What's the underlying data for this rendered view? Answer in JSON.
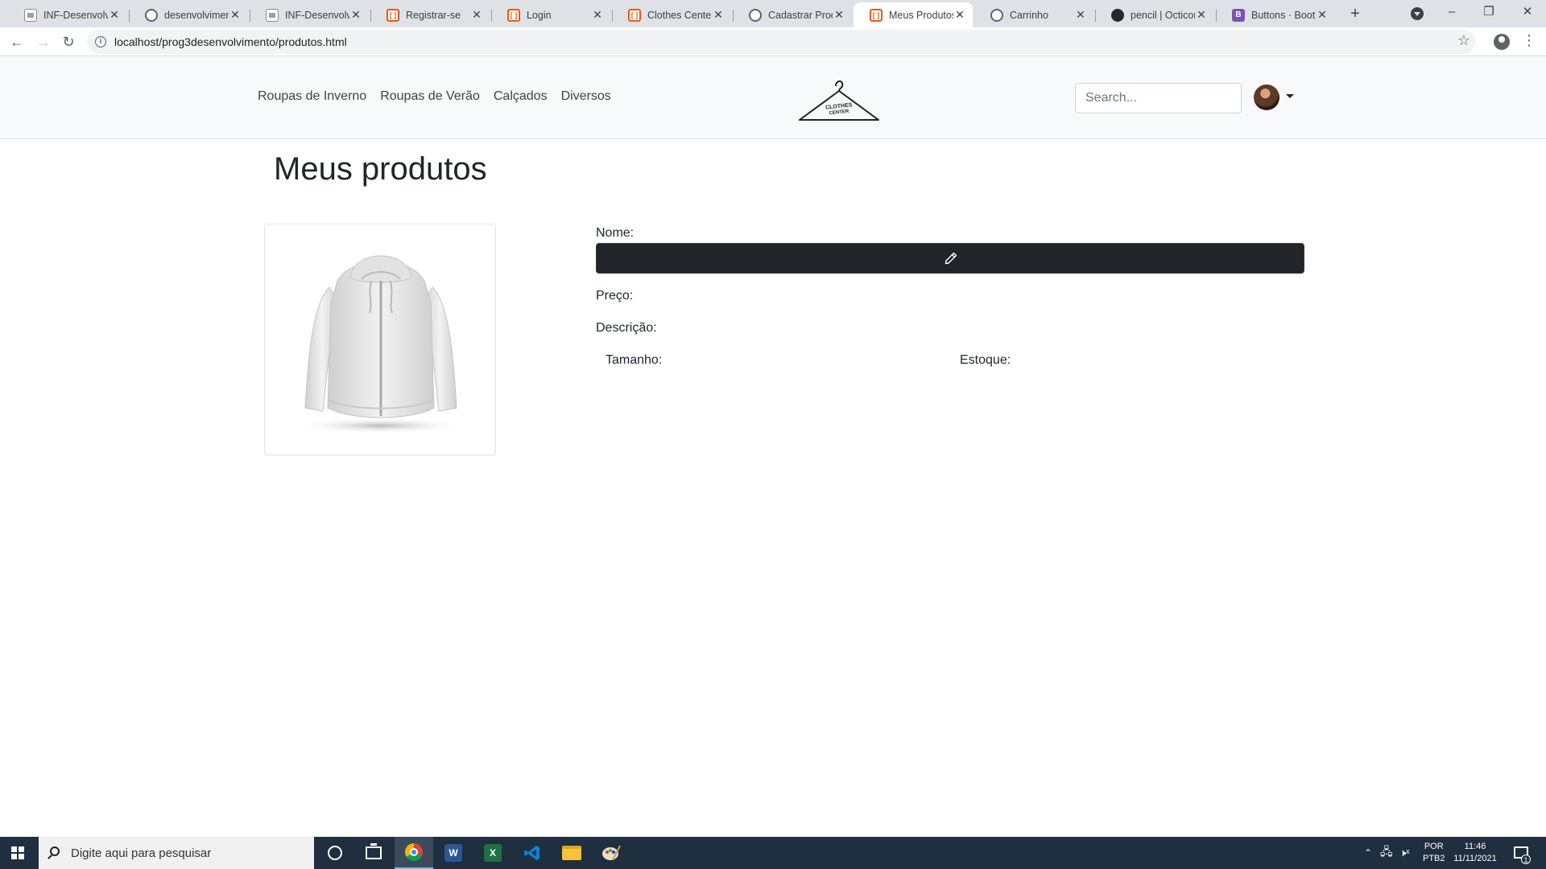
{
  "browser": {
    "tabs": [
      {
        "title": "INF-Desenvolvimento",
        "favicon": "document-icon"
      },
      {
        "title": "desenvolvimento",
        "favicon": "globe-icon"
      },
      {
        "title": "INF-Desenvolvimento",
        "favicon": "document-icon"
      },
      {
        "title": "Registrar-se",
        "favicon": "bracket-icon"
      },
      {
        "title": "Login",
        "favicon": "bracket-icon"
      },
      {
        "title": "Clothes Center",
        "favicon": "bracket-icon"
      },
      {
        "title": "Cadastrar Produto",
        "favicon": "globe-icon"
      },
      {
        "title": "Meus Produtos",
        "favicon": "bracket-icon",
        "active": true
      },
      {
        "title": "Carrinho",
        "favicon": "globe-icon"
      },
      {
        "title": "pencil | Octicons",
        "favicon": "github-icon"
      },
      {
        "title": "Buttons · Bootstrap",
        "favicon": "bootstrap-icon"
      }
    ],
    "url": "localhost/prog3desenvolvimento/produtos.html"
  },
  "navbar": {
    "links": [
      "Roupas de Inverno",
      "Roupas de Verão",
      "Calçados",
      "Diversos"
    ],
    "brand_text_1": "CLOTHES",
    "brand_text_2": "CENTER",
    "search_placeholder": "Search..."
  },
  "page": {
    "title": "Meus produtos",
    "product_image": "hooded-jacket-image",
    "fields": {
      "nome_label": "Nome:",
      "preco_label": "Preço:",
      "descricao_label": "Descrição:",
      "tamanho_label": "Tamanho:",
      "estoque_label": "Estoque:"
    }
  },
  "taskbar": {
    "search_placeholder": "Digite aqui para pesquisar",
    "word_letter": "W",
    "excel_letter": "X",
    "lang_1": "POR",
    "lang_2": "PTB2",
    "time": "11:46",
    "date": "11/11/2021",
    "notification_count": "1"
  },
  "colors": {
    "accent_dark": "#212529",
    "navbar_bg": "#f8f9fa",
    "taskbar_bg": "#1f2f3f"
  }
}
